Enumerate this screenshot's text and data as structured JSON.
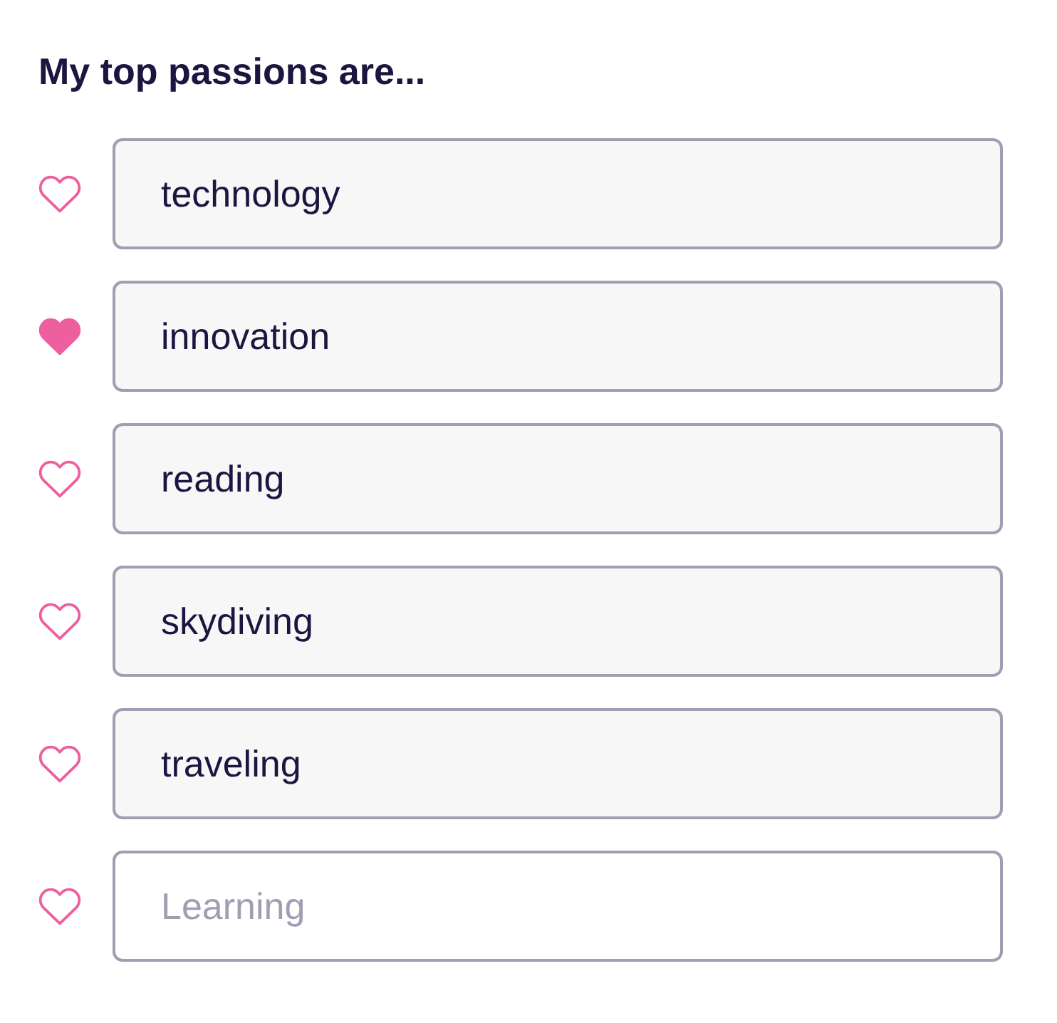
{
  "title": "My top passions are...",
  "passions": [
    {
      "value": "technology",
      "loved": false
    },
    {
      "value": "innovation",
      "loved": true
    },
    {
      "value": "reading",
      "loved": false
    },
    {
      "value": "skydiving",
      "loved": false
    },
    {
      "value": "traveling",
      "loved": false
    },
    {
      "placeholder": "Learning",
      "loved": false
    }
  ]
}
